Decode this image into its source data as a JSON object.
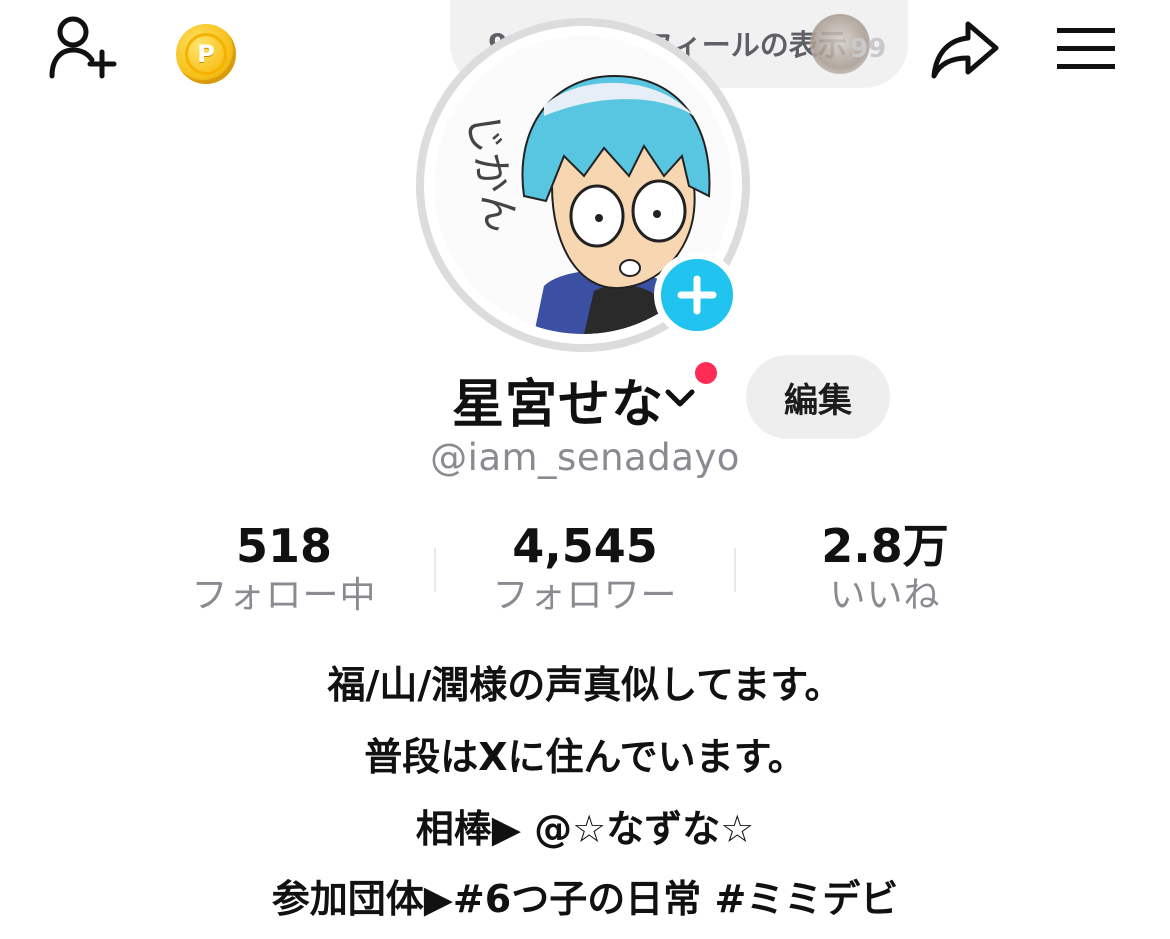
{
  "header": {
    "add_friend_icon": "person-plus-icon",
    "coin_label": "P",
    "views_text": "99件のプロフィールの表示",
    "views_count_fragment": "99",
    "share_icon": "share-arrow-icon",
    "menu_icon": "hamburger-menu-icon"
  },
  "profile": {
    "avatar_text": "じかん",
    "display_name": "星宮せな",
    "edit_label": "編集",
    "handle": "@iam_senadayo"
  },
  "stats": [
    {
      "value": "518",
      "label": "フォロー中"
    },
    {
      "value": "4,545",
      "label": "フォロワー"
    },
    {
      "value": "2.8万",
      "label": "いいね"
    }
  ],
  "bio": [
    "福/山/潤様の声真似してます。",
    "普段はXに住んでいます。",
    "相棒▶ @☆なずな☆",
    "参加団体▶#6つ子の日常 #ミミデビ"
  ],
  "colors": {
    "accent_blue": "#20c4ef",
    "notification_red": "#fe2c55",
    "muted_text": "#8a8b91",
    "pill_bg": "#eeeeef"
  }
}
